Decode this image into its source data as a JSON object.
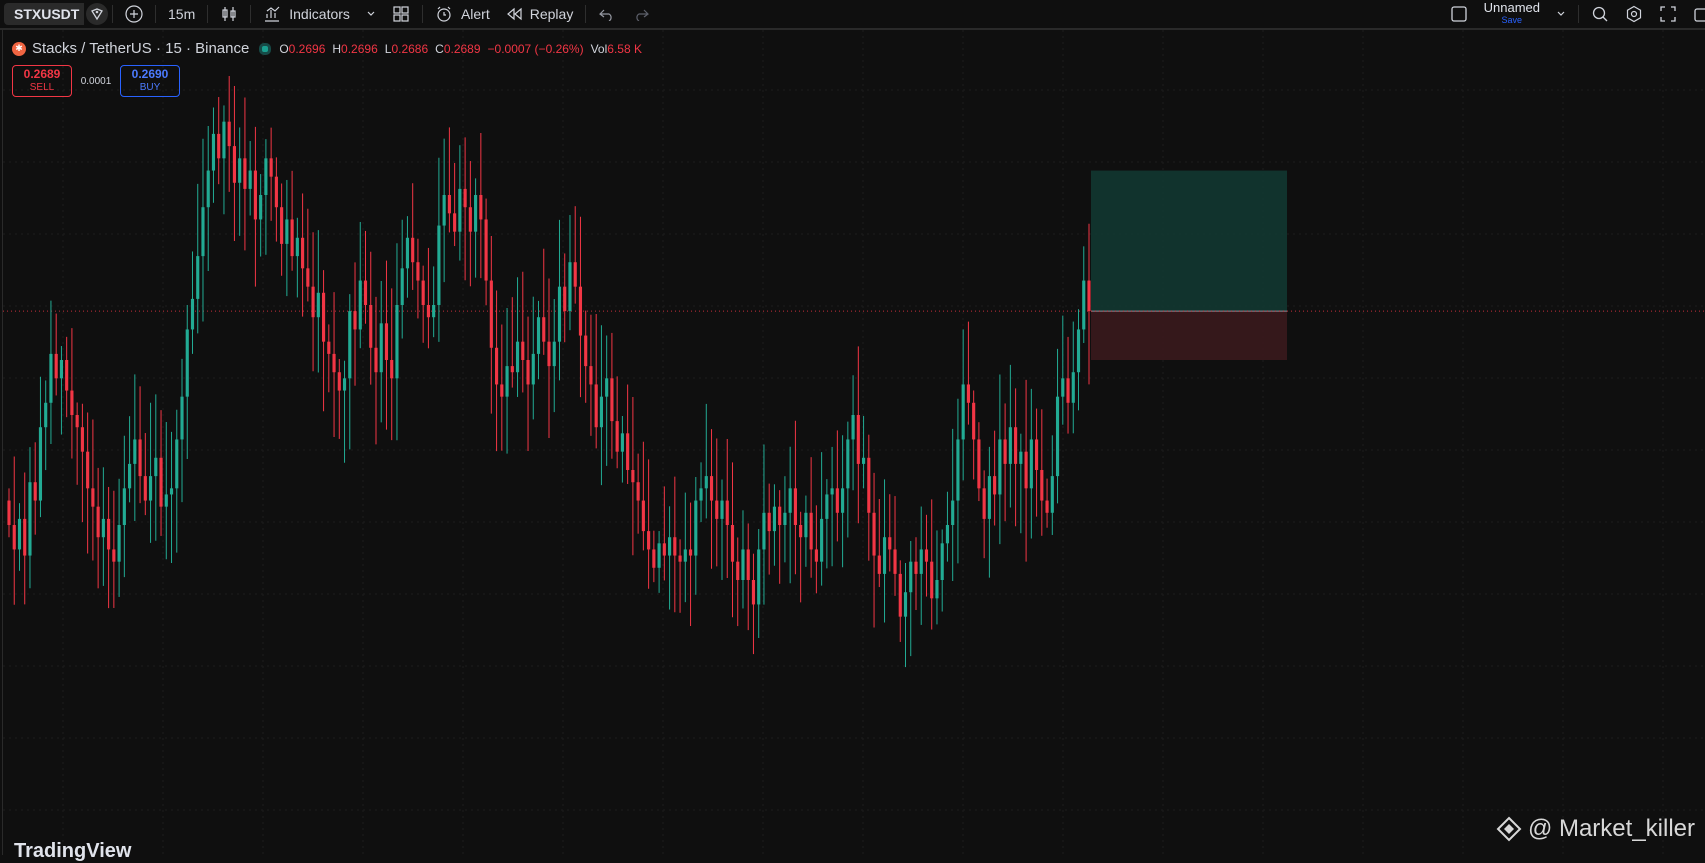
{
  "toolbar": {
    "symbol": "STXUSDT",
    "interval": "15m",
    "indicators_label": "Indicators",
    "alert_label": "Alert",
    "replay_label": "Replay",
    "layout_name": "Unnamed",
    "save_label": "Save"
  },
  "legend": {
    "title": "Stacks / TetherUS · 15 · Binance",
    "open_label": "O",
    "open": "0.2696",
    "high_label": "H",
    "high": "0.2696",
    "low_label": "L",
    "low": "0.2686",
    "close_label": "C",
    "close": "0.2689",
    "change": "−0.0007 (−0.26%)",
    "vol_label": "Vol",
    "vol": "6.58 K"
  },
  "trade": {
    "sell_price": "0.2689",
    "sell_label": "SELL",
    "spread": "0.0001",
    "buy_price": "0.2690",
    "buy_label": "BUY"
  },
  "watermark": "@ Market_killer",
  "brand": "TradingView",
  "colors": {
    "up": "#22ab94",
    "down": "#f23645",
    "bg": "#0f0f0f"
  },
  "chart_data": {
    "type": "candlestick",
    "ylim": [
      0.26,
      0.2735
    ],
    "current_price": 0.2689,
    "closes": [
      0.2654,
      0.265,
      0.2655,
      0.2649,
      0.2661,
      0.2658,
      0.267,
      0.2674,
      0.2682,
      0.2678,
      0.2681,
      0.2676,
      0.2672,
      0.267,
      0.2666,
      0.266,
      0.2657,
      0.2652,
      0.2655,
      0.265,
      0.2648,
      0.2654,
      0.266,
      0.2664,
      0.2668,
      0.2662,
      0.2658,
      0.2662,
      0.2665,
      0.2657,
      0.2659,
      0.266,
      0.2668,
      0.2675,
      0.2686,
      0.2691,
      0.2698,
      0.2706,
      0.2712,
      0.2718,
      0.2714,
      0.272,
      0.2716,
      0.271,
      0.2714,
      0.2709,
      0.2712,
      0.2704,
      0.2708,
      0.2714,
      0.2711,
      0.2706,
      0.27,
      0.2704,
      0.2698,
      0.2701,
      0.2696,
      0.2693,
      0.2688,
      0.2692,
      0.2684,
      0.2682,
      0.2679,
      0.2676,
      0.2678,
      0.2689,
      0.2686,
      0.2694,
      0.269,
      0.2683,
      0.2679,
      0.2687,
      0.2681,
      0.2678,
      0.269,
      0.2696,
      0.2701,
      0.2697,
      0.2694,
      0.269,
      0.2688,
      0.269,
      0.2703,
      0.2708,
      0.2705,
      0.2702,
      0.2709,
      0.2706,
      0.2702,
      0.2708,
      0.2704,
      0.2694,
      0.2683,
      0.2677,
      0.2675,
      0.268,
      0.2679,
      0.2684,
      0.2681,
      0.2677,
      0.2682,
      0.2688,
      0.2684,
      0.268,
      0.2684,
      0.2693,
      0.2689,
      0.2697,
      0.2693,
      0.2685,
      0.268,
      0.2677,
      0.267,
      0.2675,
      0.2678,
      0.2671,
      0.2666,
      0.2669,
      0.2663,
      0.2661,
      0.2658,
      0.2653,
      0.265,
      0.2647,
      0.2651,
      0.2649,
      0.2652,
      0.2649,
      0.2648,
      0.265,
      0.2649,
      0.2658,
      0.266,
      0.2662,
      0.2658,
      0.2655,
      0.2658,
      0.2654,
      0.2648,
      0.2645,
      0.265,
      0.2645,
      0.2641,
      0.265,
      0.2656,
      0.2653,
      0.2657,
      0.2654,
      0.2656,
      0.266,
      0.2654,
      0.2652,
      0.2656,
      0.265,
      0.2648,
      0.2655,
      0.2659,
      0.266,
      0.2656,
      0.266,
      0.2668,
      0.2672,
      0.2664,
      0.2665,
      0.2656,
      0.2649,
      0.2646,
      0.2652,
      0.265,
      0.2646,
      0.2639,
      0.2643,
      0.2648,
      0.2646,
      0.265,
      0.2648,
      0.2642,
      0.2645,
      0.2651,
      0.2654,
      0.2658,
      0.2668,
      0.2677,
      0.2674,
      0.2668,
      0.266,
      0.2655,
      0.2662,
      0.2659,
      0.2668,
      0.2664,
      0.267,
      0.2664,
      0.2666,
      0.266,
      0.2668,
      0.2663,
      0.2658,
      0.2656,
      0.2662,
      0.2675,
      0.2678,
      0.2674,
      0.2679,
      0.2686,
      0.2694,
      0.2689
    ]
  }
}
